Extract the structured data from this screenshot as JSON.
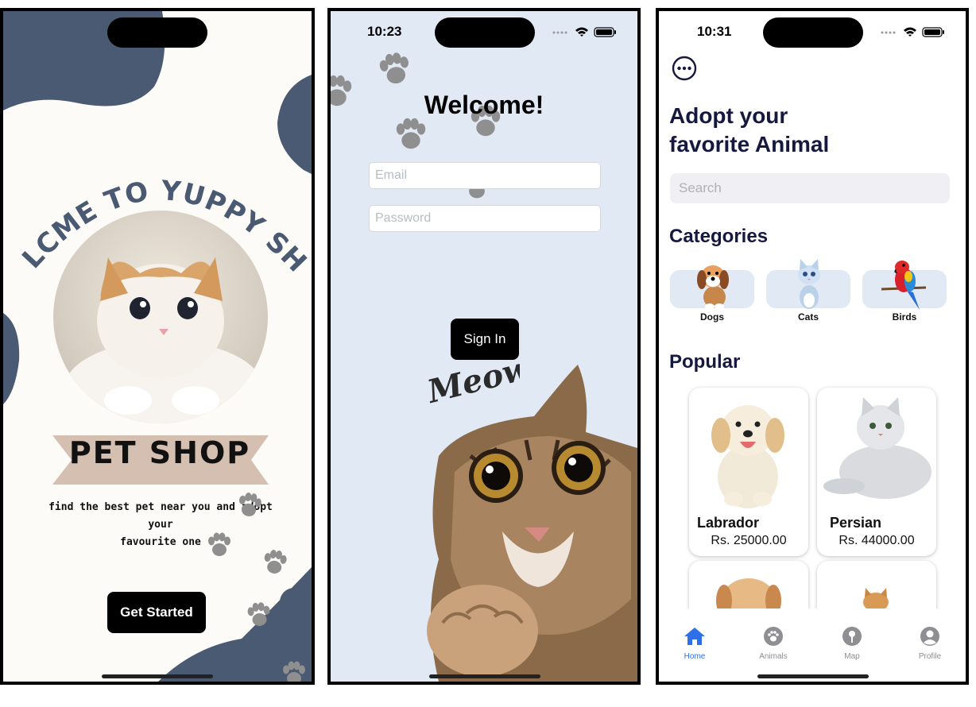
{
  "screen1": {
    "title_curve": "WELCME TO YUPPY SHOP",
    "banner": "PET SHOP",
    "subtitle_line1": "find the best pet near you and adopt your",
    "subtitle_line2": "favourite one",
    "button": "Get Started"
  },
  "screen2": {
    "time": "10:23",
    "title": "Welcome!",
    "email_placeholder": "Email",
    "password_placeholder": "Password",
    "button": "Sign In",
    "meow_text": "Meow"
  },
  "screen3": {
    "time": "10:31",
    "heading_line1": "Adopt your",
    "heading_line2": "favorite Animal",
    "search_placeholder": "Search",
    "categories_title": "Categories",
    "categories": [
      {
        "label": "Dogs"
      },
      {
        "label": "Cats"
      },
      {
        "label": "Birds"
      }
    ],
    "popular_title": "Popular",
    "popular": [
      {
        "name": "Labrador",
        "price": "Rs. 25000.00"
      },
      {
        "name": "Persian",
        "price": "Rs. 44000.00"
      }
    ],
    "tabs": [
      {
        "label": "Home",
        "icon": "home-icon",
        "active": true
      },
      {
        "label": "Animals",
        "icon": "paw-icon",
        "active": false
      },
      {
        "label": "Map",
        "icon": "map-pin-icon",
        "active": false
      },
      {
        "label": "Profile",
        "icon": "person-icon",
        "active": false
      }
    ]
  },
  "colors": {
    "navy": "#15183f",
    "blob": "#4a5a72",
    "banner": "#d5bfb0",
    "light_blue": "#e1e9f5",
    "active_tab": "#2f6fe8"
  }
}
